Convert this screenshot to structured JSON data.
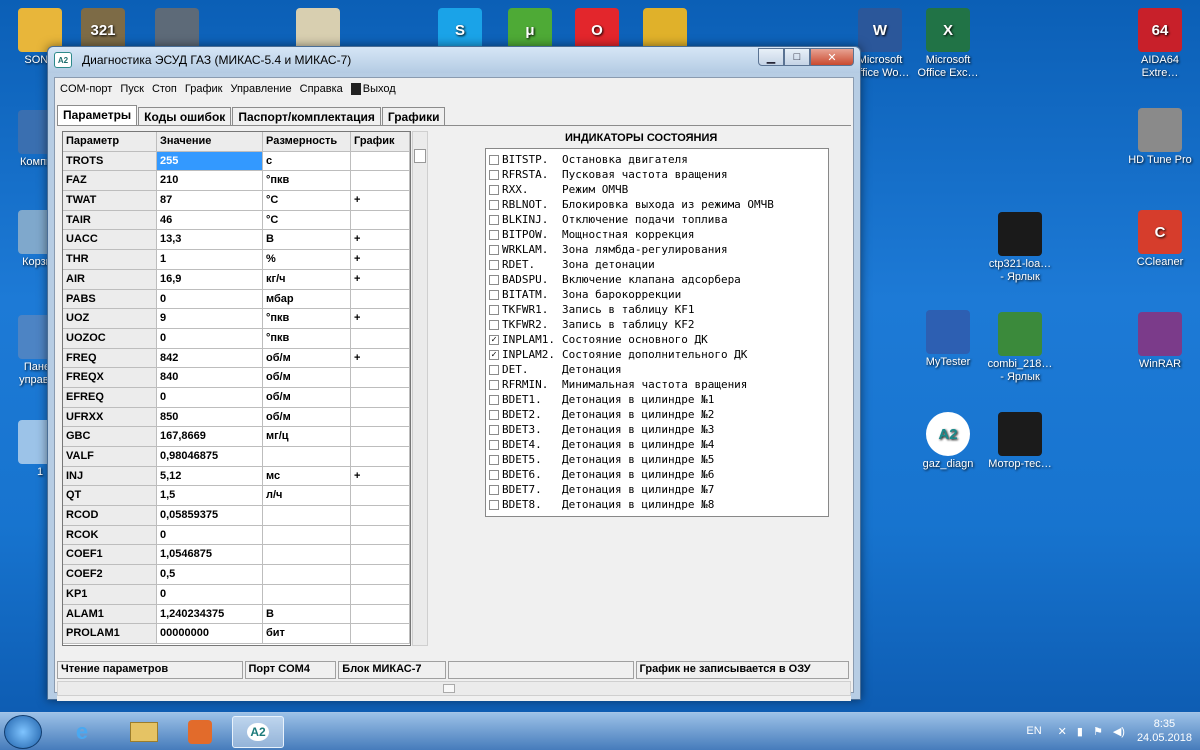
{
  "desktop": {
    "icons": [
      {
        "name": "sony",
        "label": "SONY",
        "glyph": "",
        "color": "#e8b63a"
      },
      {
        "name": "media-player",
        "label": "",
        "glyph": "321",
        "color": "#7d6b46"
      },
      {
        "name": "video-camera",
        "label": "",
        "glyph": "",
        "color": "#5d6a78"
      },
      {
        "name": "paint",
        "label": "",
        "glyph": "",
        "color": "#d8cfb0"
      },
      {
        "name": "skype",
        "label": "",
        "glyph": "S",
        "color": "#1aa3e8"
      },
      {
        "name": "utorrent",
        "label": "",
        "glyph": "μ",
        "color": "#4eaa36"
      },
      {
        "name": "opera",
        "label": "",
        "glyph": "O",
        "color": "#e3262c"
      },
      {
        "name": "chrome",
        "label": "",
        "glyph": "",
        "color": "#e0b12a"
      },
      {
        "name": "word",
        "label": "Microsoft\nOffice Wo…",
        "glyph": "W",
        "color": "#2b579a"
      },
      {
        "name": "excel",
        "label": "Microsoft\nOffice Exc…",
        "glyph": "X",
        "color": "#217346"
      },
      {
        "name": "aida64",
        "label": "AIDA64\nExtre…",
        "glyph": "64",
        "color": "#c8202a"
      },
      {
        "name": "computer",
        "label": "Компью",
        "glyph": "",
        "color": "#3a6fb0"
      },
      {
        "name": "hd-tune",
        "label": "HD Tune Pro",
        "glyph": "",
        "color": "#8a8a8a"
      },
      {
        "name": "recycle-bin",
        "label": "Корзин",
        "glyph": "",
        "color": "#7fa8cc"
      },
      {
        "name": "ctp321",
        "label": "ctp321-loa…\n- Ярлык",
        "glyph": "",
        "color": "#1a1a1a"
      },
      {
        "name": "ccleaner",
        "label": "CCleaner",
        "glyph": "C",
        "color": "#d63d2c"
      },
      {
        "name": "control-panel",
        "label": "Панел\nуправле",
        "glyph": "",
        "color": "#4d84c4"
      },
      {
        "name": "mytester",
        "label": "MyTester",
        "glyph": "",
        "color": "#2d5fb2"
      },
      {
        "name": "combi",
        "label": "combi_218…\n- Ярлык",
        "glyph": "",
        "color": "#3b8a3b"
      },
      {
        "name": "winrar",
        "label": "WinRAR",
        "glyph": "",
        "color": "#7b3b8a"
      },
      {
        "name": "desktop-item-1",
        "label": "1",
        "glyph": "",
        "color": "#9cc3e8"
      },
      {
        "name": "gaz-diagn",
        "label": "gaz_diagn",
        "glyph": "A2",
        "color": "#ffffff"
      },
      {
        "name": "motor-tester",
        "label": "Мотор-тес…",
        "glyph": "",
        "color": "#1b1b1b"
      }
    ]
  },
  "window": {
    "title": "Диагностика ЭСУД ГАЗ (МИКАС-5.4 и МИКАС-7)",
    "app_icon": "A2",
    "menu": [
      "COM-порт",
      "Пуск",
      "Стоп",
      "График",
      "Управление",
      "Справка"
    ],
    "exit_label": "Выход",
    "tabs": [
      "Параметры",
      "Коды ошибок",
      "Паспорт/комплектация",
      "Графики"
    ],
    "grid": {
      "headers": [
        "Параметр",
        "Значение",
        "Размерность",
        "График"
      ],
      "rows": [
        [
          "TROTS",
          "255",
          "c",
          ""
        ],
        [
          "FAZ",
          "210",
          "°пкв",
          ""
        ],
        [
          "TWAT",
          "87",
          "°C",
          "+"
        ],
        [
          "TAIR",
          "46",
          "°C",
          ""
        ],
        [
          "UACC",
          "13,3",
          "B",
          "+"
        ],
        [
          "THR",
          "1",
          "%",
          "+"
        ],
        [
          "AIR",
          "16,9",
          "кг/ч",
          "+"
        ],
        [
          "PABS",
          "0",
          "мбар",
          ""
        ],
        [
          "UOZ",
          "9",
          "°пкв",
          "+"
        ],
        [
          "UOZOC",
          "0",
          "°пкв",
          ""
        ],
        [
          "FREQ",
          "842",
          "об/м",
          "+"
        ],
        [
          "FREQX",
          "840",
          "об/м",
          ""
        ],
        [
          "EFREQ",
          "0",
          "об/м",
          ""
        ],
        [
          "UFRXX",
          "850",
          "об/м",
          ""
        ],
        [
          "GBC",
          "167,8669",
          "мг/ц",
          ""
        ],
        [
          "VALF",
          "0,98046875",
          "",
          ""
        ],
        [
          "INJ",
          "5,12",
          "мс",
          "+"
        ],
        [
          "QT",
          "1,5",
          "л/ч",
          ""
        ],
        [
          "RCOD",
          "0,05859375",
          "",
          ""
        ],
        [
          "RCOK",
          "0",
          "",
          ""
        ],
        [
          "COEF1",
          "1,0546875",
          "",
          ""
        ],
        [
          "COEF2",
          "0,5",
          "",
          ""
        ],
        [
          "KP1",
          "0",
          "",
          ""
        ],
        [
          "ALAM1",
          "1,240234375",
          "B",
          ""
        ],
        [
          "PROLAM1",
          "00000000",
          "бит",
          ""
        ]
      ]
    },
    "indicators": {
      "title": "ИНДИКАТОРЫ СОСТОЯНИЯ",
      "items": [
        {
          "code": "BITSTP.",
          "desc": "Остановка двигателя",
          "checked": false
        },
        {
          "code": "RFRSTA.",
          "desc": "Пусковая частота вращения",
          "checked": false
        },
        {
          "code": "RXX.",
          "desc": "Режим ОМЧВ",
          "checked": false
        },
        {
          "code": "RBLNOT.",
          "desc": "Блокировка выхода из режима ОМЧВ",
          "checked": false
        },
        {
          "code": "BLKINJ.",
          "desc": "Отключение подачи топлива",
          "checked": false
        },
        {
          "code": "BITPOW.",
          "desc": "Мощностная коррекция",
          "checked": false
        },
        {
          "code": "WRKLAM.",
          "desc": "Зона лямбда-регулирования",
          "checked": false
        },
        {
          "code": "RDET.",
          "desc": "Зона детонации",
          "checked": false
        },
        {
          "code": "BADSPU.",
          "desc": "Включение клапана адсорбера",
          "checked": false
        },
        {
          "code": "BITATM.",
          "desc": "Зона барокоррекции",
          "checked": false
        },
        {
          "code": "TKFWR1.",
          "desc": "Запись в таблицу KF1",
          "checked": false
        },
        {
          "code": "TKFWR2.",
          "desc": "Запись в таблицу KF2",
          "checked": false
        },
        {
          "code": "INPLAM1.",
          "desc": "Состояние основного ДК",
          "checked": true
        },
        {
          "code": "INPLAM2.",
          "desc": "Состояние дополнительного ДК",
          "checked": true
        },
        {
          "code": "DET.",
          "desc": "Детонация",
          "checked": false
        },
        {
          "code": "RFRMIN.",
          "desc": "Минимальная частота вращения",
          "checked": false
        },
        {
          "code": "BDET1.",
          "desc": "Детонация в цилиндре №1",
          "checked": false
        },
        {
          "code": "BDET2.",
          "desc": "Детонация в цилиндре №2",
          "checked": false
        },
        {
          "code": "BDET3.",
          "desc": "Детонация в цилиндре №3",
          "checked": false
        },
        {
          "code": "BDET4.",
          "desc": "Детонация в цилиндре №4",
          "checked": false
        },
        {
          "code": "BDET5.",
          "desc": "Детонация в цилиндре №5",
          "checked": false
        },
        {
          "code": "BDET6.",
          "desc": "Детонация в цилиндре №6",
          "checked": false
        },
        {
          "code": "BDET7.",
          "desc": "Детонация в цилиндре №7",
          "checked": false
        },
        {
          "code": "BDET8.",
          "desc": "Детонация в цилиндре №8",
          "checked": false
        }
      ]
    },
    "status": [
      "Чтение параметров",
      "Порт COM4",
      "Блок МИКАС-7",
      "",
      "График не записывается в ОЗУ"
    ]
  },
  "taskbar": {
    "items": [
      "ie-icon",
      "explorer-icon",
      "media-icon",
      "A2"
    ],
    "language": "EN",
    "time": "8:35",
    "date": "24.05.2018"
  }
}
